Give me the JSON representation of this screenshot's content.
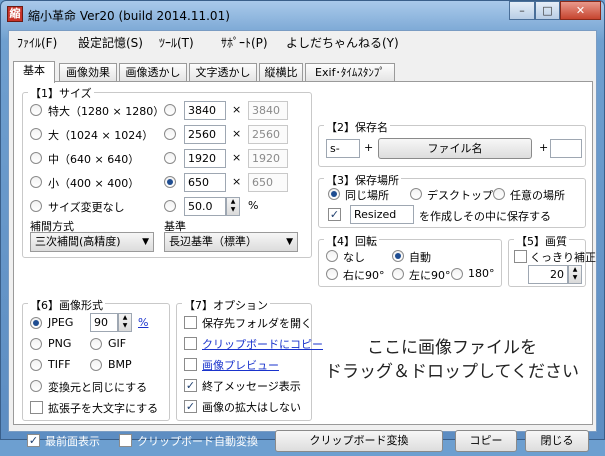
{
  "window": {
    "title": "縮小革命 Ver20  (build 2014.11.01)",
    "app_icon_glyph": "縮"
  },
  "menu": [
    "ﾌｧｲﾙ(F)",
    "設定記憶(S)",
    "ﾂｰﾙ(T)",
    "ｻﾎﾟｰﾄ(P)",
    "よしだちゃんねる(Y)"
  ],
  "tabs": [
    "基本",
    "画像効果",
    "画像透かし",
    "文字透かし",
    "縦横比",
    "Exif･ﾀｲﾑｽﾀﾝﾌﾟ"
  ],
  "size": {
    "group_label": "【1】サイズ",
    "presets": [
      {
        "label": "特大（1280 × 1280）",
        "selected": false
      },
      {
        "label": "大（1024 × 1024）",
        "selected": false
      },
      {
        "label": "中（640 × 640）",
        "selected": false
      },
      {
        "label": "小（400 × 400）",
        "selected": false
      },
      {
        "label": "サイズ変更なし",
        "selected": false
      }
    ],
    "custom": [
      {
        "w": "3840",
        "h": "3840",
        "selected": false
      },
      {
        "w": "2560",
        "h": "2560",
        "selected": false
      },
      {
        "w": "1920",
        "h": "1920",
        "selected": false
      },
      {
        "w": "650",
        "h": "650",
        "selected": true
      }
    ],
    "times": "×",
    "percent_value": "50.0",
    "percent_unit": "%",
    "interp_label": "補間方式",
    "interp_value": "三次補間(高精度)",
    "basis_label": "基準",
    "basis_value": "長辺基準（標準）"
  },
  "savename": {
    "group_label": "【2】保存名",
    "prefix": "s-",
    "plus": "+",
    "button": "ファイル名",
    "suffix": ""
  },
  "saveplace": {
    "group_label": "【3】保存場所",
    "options": [
      {
        "label": "同じ場所",
        "selected": true
      },
      {
        "label": "デスクトップ",
        "selected": false
      },
      {
        "label": "任意の場所",
        "selected": false
      }
    ],
    "folder_checked": true,
    "folder_name": "Resized",
    "folder_suffix": "を作成しその中に保存する"
  },
  "rotate": {
    "group_label": "【4】回転",
    "options": [
      {
        "label": "なし",
        "selected": false
      },
      {
        "label": "自動",
        "selected": true
      },
      {
        "label": "右に90°",
        "selected": false
      },
      {
        "label": "左に90°",
        "selected": false
      },
      {
        "label": "180°",
        "selected": false
      }
    ]
  },
  "quality": {
    "group_label": "【5】画質",
    "sharpen_label": "くっきり補正",
    "sharpen_checked": false,
    "value": "20"
  },
  "format": {
    "group_label": "【6】画像形式",
    "jpeg_label": "JPEG",
    "jpeg_quality": "90",
    "percent_link": "%",
    "options": [
      "PNG",
      "GIF",
      "TIFF",
      "BMP"
    ],
    "same_label": "変換元と同じにする",
    "upper_ext_label": "拡張子を大文字にする"
  },
  "options7": {
    "group_label": "【7】オプション",
    "items": [
      {
        "label": "保存先フォルダを開く",
        "checked": false,
        "link": false
      },
      {
        "label": "クリップボードにコピー",
        "checked": false,
        "link": true
      },
      {
        "label": "画像プレビュー",
        "checked": false,
        "link": true
      },
      {
        "label": "終了メッセージ表示",
        "checked": true,
        "link": false
      },
      {
        "label": "画像の拡大はしない",
        "checked": true,
        "link": false
      }
    ]
  },
  "drop": {
    "line1": "ここに画像ファイルを",
    "line2": "ドラッグ＆ドロップしてください"
  },
  "bottom": {
    "topmost_label": "最前面表示",
    "topmost_checked": true,
    "clip_auto_label": "クリップボード自動変換",
    "clip_auto_checked": false,
    "clip_convert": "クリップボード変換",
    "copy": "コピー",
    "close": "閉じる"
  }
}
